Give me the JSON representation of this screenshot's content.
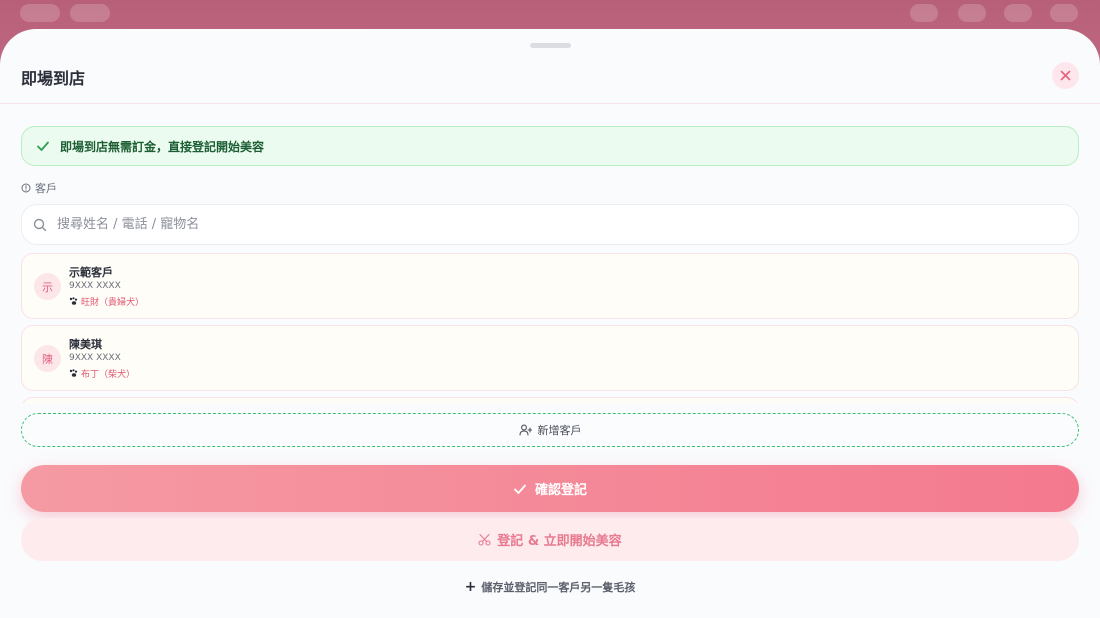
{
  "sheet": {
    "title": "即場到店",
    "close_label": "×"
  },
  "notice": {
    "text": "即場到店無需訂金，直接登記開始美容"
  },
  "client_section": {
    "label": "客戶"
  },
  "search": {
    "placeholder": "搜尋姓名 / 電話 / 寵物名",
    "value": ""
  },
  "clients": [
    {
      "initial": "示",
      "name": "示範客戶",
      "phone": "9XXX XXXX",
      "pet": "旺財（貴婦犬）"
    },
    {
      "initial": "陳",
      "name": "陳美琪",
      "phone": "9XXX XXXX",
      "pet": "布丁（柴犬）"
    }
  ],
  "actions": {
    "add_client": "新增客戶",
    "confirm": "確認登記",
    "start_grooming": "登記 & 立即開始美容",
    "save_another": "儲存並登記同一客戶另一隻毛孩"
  },
  "colors": {
    "accent": "#f4798f",
    "success": "#3cbf73",
    "text": "#2b2f3a"
  }
}
